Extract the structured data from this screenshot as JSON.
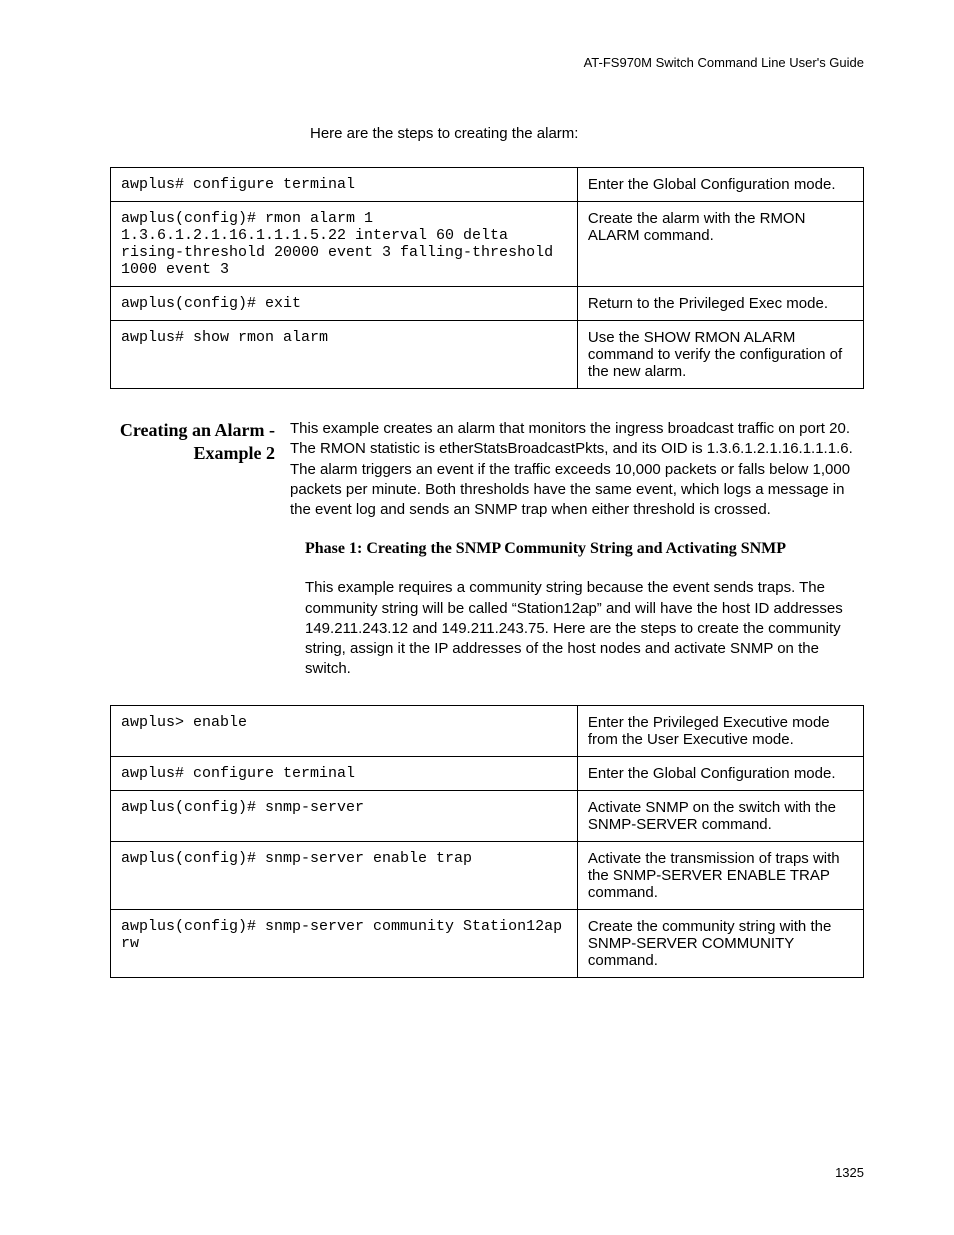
{
  "header": {
    "guide_title": "AT-FS970M Switch Command Line User's Guide"
  },
  "intro": "Here are the steps to creating the alarm:",
  "table1": {
    "rows": [
      {
        "cmd": "awplus# configure terminal",
        "desc": "Enter the Global Configuration mode."
      },
      {
        "cmd": "awplus(config)# rmon alarm 1 1.3.6.1.2.1.16.1.1.1.5.22 interval 60 delta rising-threshold 20000 event 3 falling-threshold 1000 event 3",
        "desc": "Create the alarm with the RMON ALARM command."
      },
      {
        "cmd": "awplus(config)# exit",
        "desc": "Return to the Privileged Exec mode."
      },
      {
        "cmd": "awplus# show rmon alarm",
        "desc": "Use the SHOW RMON ALARM command to verify the configuration of the new alarm."
      }
    ]
  },
  "section": {
    "heading": "Creating an Alarm - Example 2",
    "body": "This example creates an alarm that monitors the ingress broadcast traffic on port 20. The RMON statistic is etherStatsBroadcastPkts, and its OID is 1.3.6.1.2.1.16.1.1.1.6. The alarm triggers an event if the traffic exceeds 10,000 packets or falls below 1,000 packets per minute. Both thresholds have the same event, which logs a message in the event log and sends an SNMP trap when either threshold is crossed."
  },
  "phase": {
    "heading": "Phase 1: Creating the SNMP Community String and Activating SNMP",
    "body": "This example requires a community string because the event sends traps. The community string will be called “Station12ap” and will have the host ID addresses 149.211.243.12 and 149.211.243.75. Here are the steps to create the community string, assign it the IP addresses of the host nodes and activate SNMP on the switch."
  },
  "table2": {
    "rows": [
      {
        "cmd": "awplus> enable",
        "desc": "Enter the Privileged Executive mode from the User Executive mode."
      },
      {
        "cmd": "awplus# configure terminal",
        "desc": "Enter the Global Configuration mode."
      },
      {
        "cmd": "awplus(config)# snmp-server",
        "desc": "Activate SNMP on the switch with the SNMP-SERVER command."
      },
      {
        "cmd": "awplus(config)# snmp-server enable trap",
        "desc": "Activate the transmission of traps with the SNMP-SERVER ENABLE TRAP command."
      },
      {
        "cmd": "awplus(config)# snmp-server community Station12ap rw",
        "desc": "Create the community string with the SNMP-SERVER COMMUNITY command."
      }
    ]
  },
  "page_number": "1325"
}
